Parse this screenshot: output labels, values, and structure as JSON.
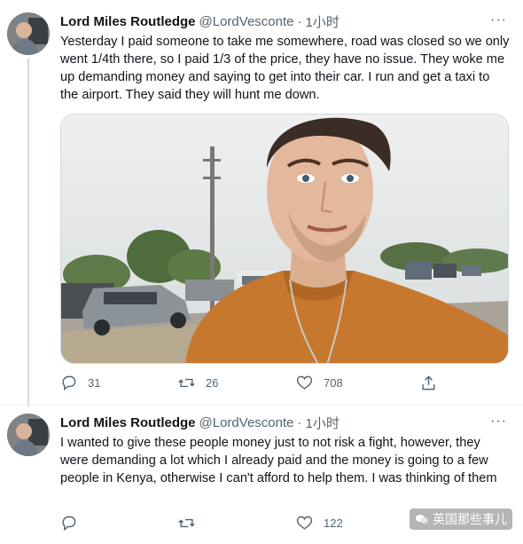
{
  "tweets": [
    {
      "author": {
        "name": "Lord Miles Routledge",
        "handle": "@LordVesconte",
        "separator": "·",
        "time": "1小时"
      },
      "text": "Yesterday I paid someone to take me somewhere, road was closed so we only went 1/4th there, so I paid 1/3 of the price, they have no issue. They woke me up demanding money and saying to get into their car. I run and get a taxi to the airport. They said they will hunt me down.",
      "has_media": true,
      "stats": {
        "replies": "31",
        "retweets": "26",
        "likes": "708"
      }
    },
    {
      "author": {
        "name": "Lord Miles Routledge",
        "handle": "@LordVesconte",
        "separator": "·",
        "time": "1小时"
      },
      "text": "I wanted to give these people money just to not risk a fight, however, they were demanding a lot which I already paid and the money is going to a few people in Kenya, otherwise I can't afford to help them. I was thinking of them",
      "has_media": false,
      "stats": {
        "replies": "",
        "retweets": "",
        "likes": "122"
      }
    }
  ],
  "more_label": "···",
  "watermark": {
    "text": "英国那些事儿"
  },
  "icons": {
    "reply": "reply-icon",
    "retweet": "retweet-icon",
    "like": "like-icon",
    "share": "share-icon",
    "more": "more-icon"
  },
  "colors": {
    "text_primary": "#0f1419",
    "text_secondary": "#536471",
    "border": "#cfd9de",
    "shirt": "#c7782f"
  }
}
